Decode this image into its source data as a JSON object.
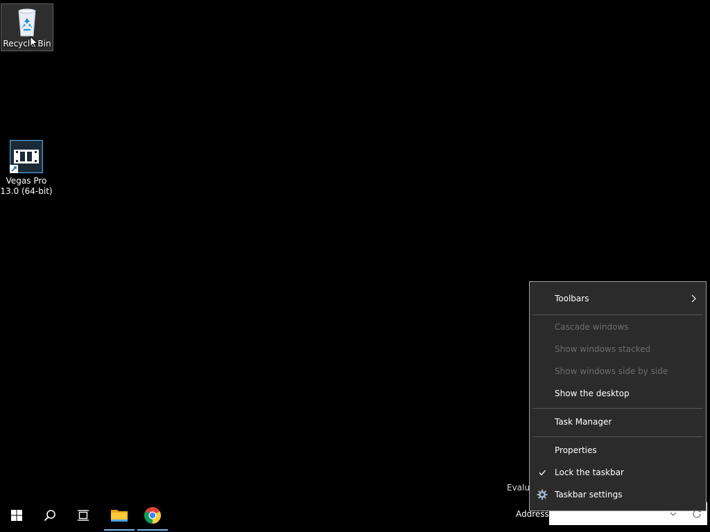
{
  "desktop": {
    "icons": [
      {
        "label": "Recycle Bin"
      },
      {
        "label_line1": "Vegas Pro",
        "label_line2": "13.0 (64-bit)"
      }
    ],
    "watermark_text": "Evalua"
  },
  "taskbar": {
    "address_label": "Address",
    "address_value": "",
    "pinned": [
      "start-icon",
      "search-icon",
      "task-view-icon",
      "file-explorer-icon",
      "chrome-icon"
    ],
    "accent_color": "#76b9ed"
  },
  "context_menu": {
    "items": [
      {
        "label": "Toolbars",
        "enabled": true,
        "submenu": true
      },
      {
        "label": "Cascade windows",
        "enabled": false
      },
      {
        "label": "Show windows stacked",
        "enabled": false
      },
      {
        "label": "Show windows side by side",
        "enabled": false
      },
      {
        "label": "Show the desktop",
        "enabled": true
      },
      {
        "label": "Task Manager",
        "enabled": true
      },
      {
        "label": "Properties",
        "enabled": true
      },
      {
        "label": "Lock the taskbar",
        "enabled": true,
        "checked": true
      },
      {
        "label": "Taskbar settings",
        "enabled": true,
        "icon": "gear-icon"
      }
    ],
    "background_color": "#2b2b2b",
    "disabled_color": "#6d6d6d"
  }
}
